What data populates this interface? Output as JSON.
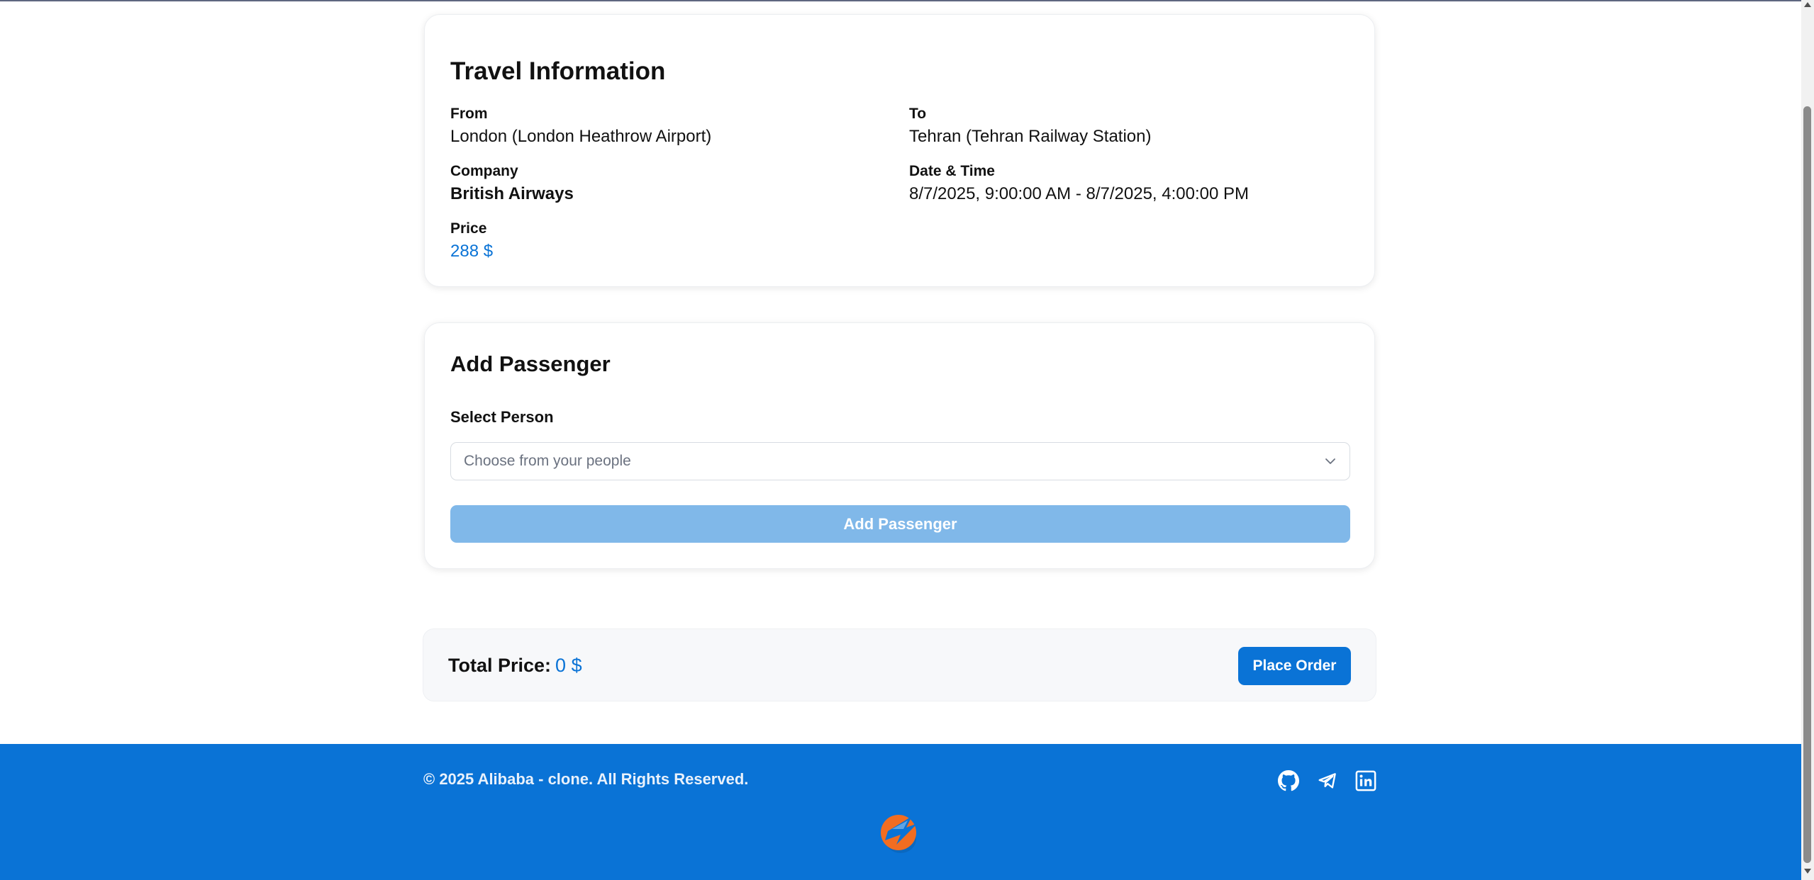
{
  "travel_info": {
    "title": "Travel Information",
    "from_label": "From",
    "from_value": "London (London Heathrow Airport)",
    "to_label": "To",
    "to_value": "Tehran (Tehran Railway Station)",
    "company_label": "Company",
    "company_value": "British Airways",
    "datetime_label": "Date & Time",
    "datetime_value": "8/7/2025, 9:00:00 AM - 8/7/2025, 4:00:00 PM",
    "price_label": "Price",
    "price_value": "288 $"
  },
  "add_passenger": {
    "title": "Add Passenger",
    "select_label": "Select Person",
    "select_placeholder": "Choose from your people",
    "button_label": "Add Passenger"
  },
  "summary": {
    "total_label": "Total Price:",
    "total_value": "0 $",
    "order_button": "Place Order"
  },
  "footer": {
    "copyright": "© 2025 Alibaba - clone. All Rights Reserved.",
    "social_icons": [
      "github-icon",
      "telegram-icon",
      "linkedin-icon"
    ],
    "logo": "alibaba-logo-icon"
  },
  "colors": {
    "accent": "#0a73d6",
    "disabled_button": "#80b8e9",
    "footer_bg": "#0a73d6",
    "logo_orange": "#f26d21"
  }
}
